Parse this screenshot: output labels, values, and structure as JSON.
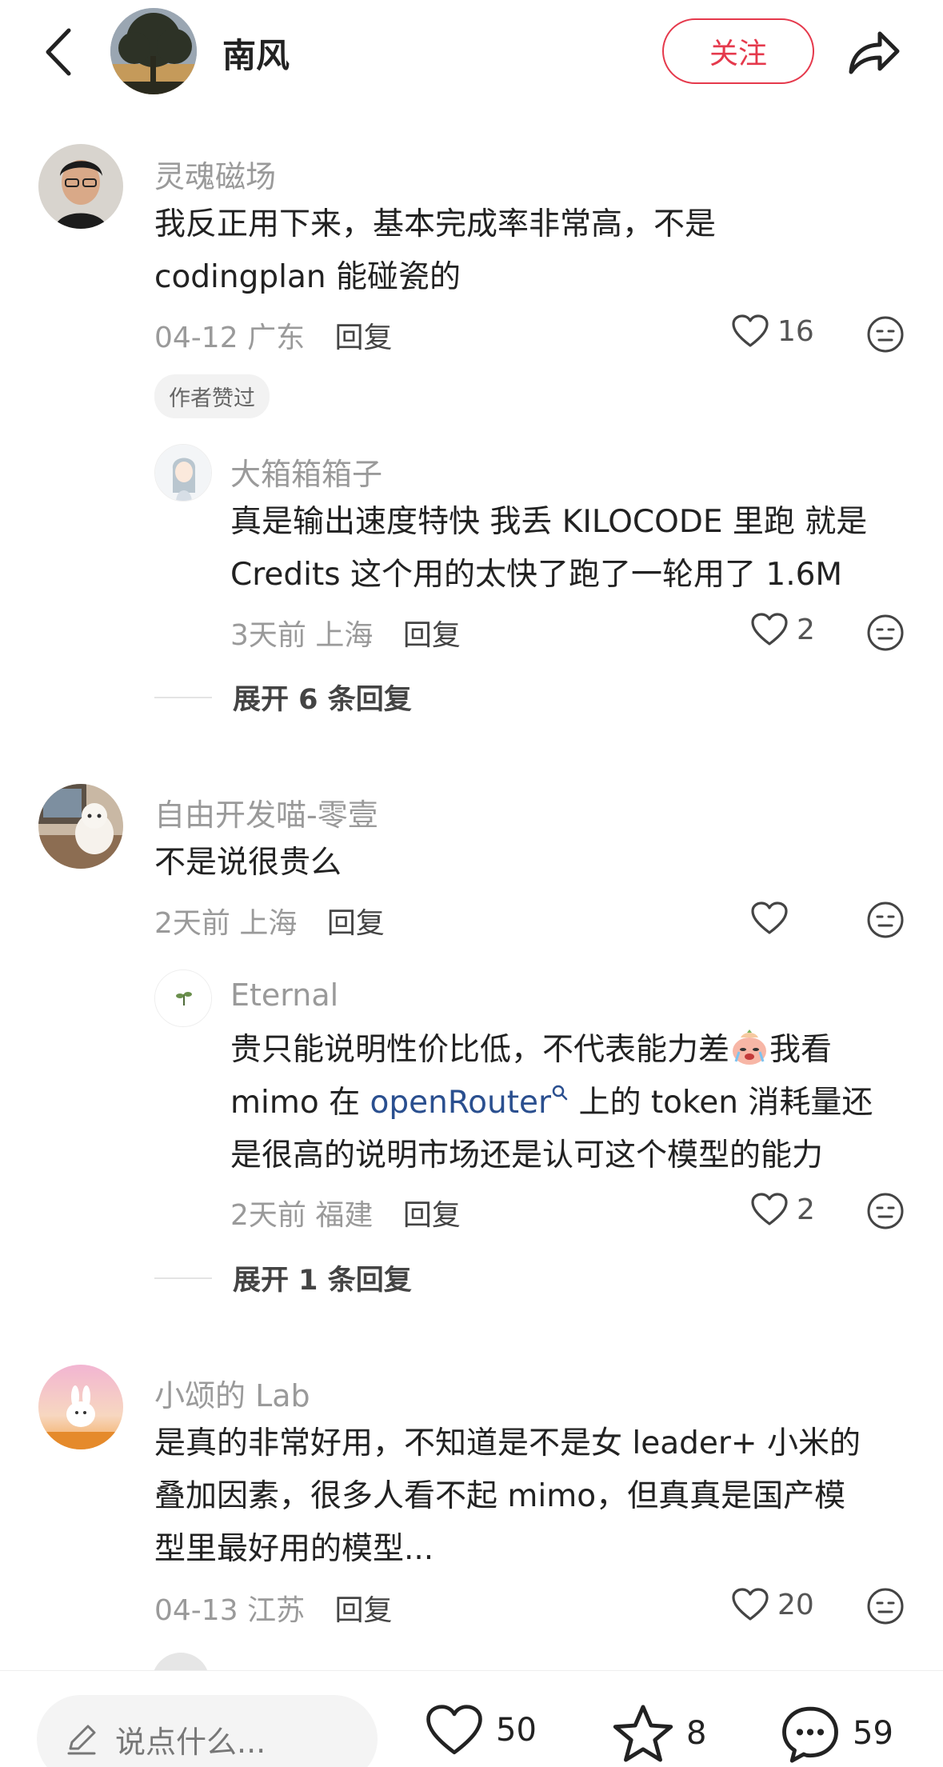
{
  "header": {
    "name": "南风",
    "follow_label": "关注"
  },
  "comments": [
    {
      "user": "灵魂磁场",
      "lines": [
        "我反正用下来，基本完成率非常高，不是",
        "codingplan 能碰瓷的"
      ],
      "date": "04-12",
      "location": "广东",
      "reply": "回复",
      "likes": "16",
      "tag": "作者赞过",
      "sub": {
        "user": "大箱箱箱子",
        "lines": [
          "真是输出速度特快 我丢 KILOCODE 里跑 就是",
          "Credits 这个用的太快了跑了一轮用了 1.6M"
        ],
        "date": "3天前",
        "location": "上海",
        "reply": "回复",
        "likes": "2"
      },
      "expand": "展开 6 条回复"
    },
    {
      "user": "自由开发喵-零壹",
      "lines": [
        "不是说很贵么"
      ],
      "date": "2天前",
      "location": "上海",
      "reply": "回复",
      "likes": "",
      "sub": {
        "user": "Eternal",
        "line1": "贵只能说明性价比低，不代表能力差",
        "line1_tail": "我看",
        "line2_pre": "mimo 在 ",
        "line2_link": "openRouter",
        "line2_post": " 上的 token 消耗量还",
        "line3": "是很高的说明市场还是认可这个模型的能力",
        "date": "2天前",
        "location": "福建",
        "reply": "回复",
        "likes": "2"
      },
      "expand": "展开 1 条回复"
    },
    {
      "user": "小颂的 Lab",
      "lines": [
        "是真的非常好用，不知道是不是女 leader+ 小米的",
        "叠加因素，很多人看不起 mimo，但真真是国产模",
        "型里最好用的模型..."
      ],
      "date": "04-13",
      "location": "江苏",
      "reply": "回复",
      "likes": "20"
    }
  ],
  "bottom": {
    "placeholder": "说点什么...",
    "likes": "50",
    "stars": "8",
    "comments": "59"
  },
  "colors": {
    "accent": "#e5394c",
    "link": "#2a4f8f",
    "muted": "#9a9a9a"
  },
  "icons": [
    "back-icon",
    "share-icon",
    "heart-icon",
    "face-icon",
    "pencil-icon",
    "star-icon",
    "comment-icon",
    "search-link-icon",
    "crying-emoji-icon"
  ]
}
